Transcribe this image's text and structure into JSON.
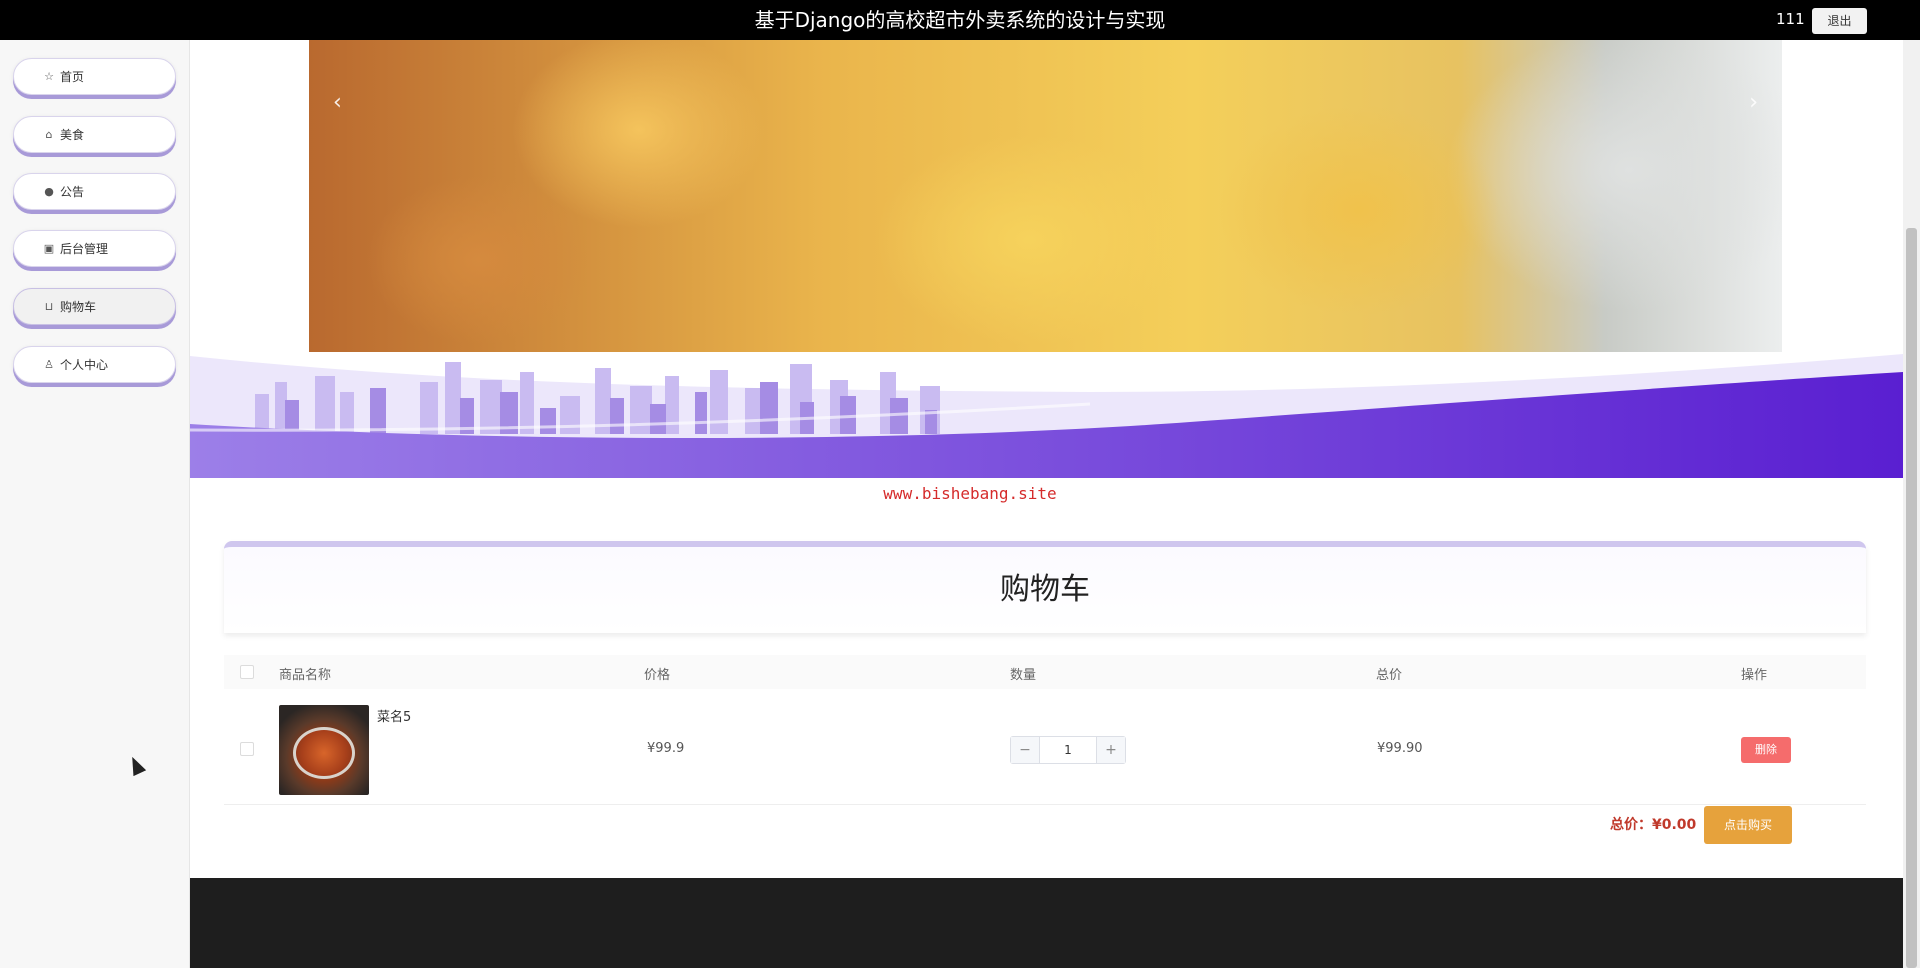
{
  "header": {
    "title": "基于Django的高校超市外卖系统的设计与实现",
    "username": "111",
    "logout_label": "退出"
  },
  "sidebar": {
    "items": [
      {
        "label": "首页",
        "icon": "star-icon"
      },
      {
        "label": "美食",
        "icon": "bag-icon"
      },
      {
        "label": "公告",
        "icon": "info-icon"
      },
      {
        "label": "后台管理",
        "icon": "briefcase-icon"
      },
      {
        "label": "购物车",
        "icon": "cart-icon",
        "active": true
      },
      {
        "label": "个人中心",
        "icon": "user-icon"
      }
    ]
  },
  "banner": {
    "prev_label": "‹",
    "next_label": "›"
  },
  "site_text": "www.bishebang.site",
  "cart": {
    "title": "购物车",
    "columns": [
      "商品名称",
      "价格",
      "数量",
      "总价",
      "操作"
    ],
    "items": [
      {
        "name": "菜名5",
        "price": "¥99.9",
        "quantity": "1",
        "total": "¥99.90",
        "delete_label": "删除"
      }
    ],
    "sum_label": "总价：",
    "sum_value": "¥0.00",
    "buy_label": "点击购买"
  },
  "colors": {
    "accent_purple": "#6c3fd8",
    "delete_red": "#f56c6c",
    "buy_orange": "#e6a23c",
    "site_red": "#d52b2b"
  }
}
